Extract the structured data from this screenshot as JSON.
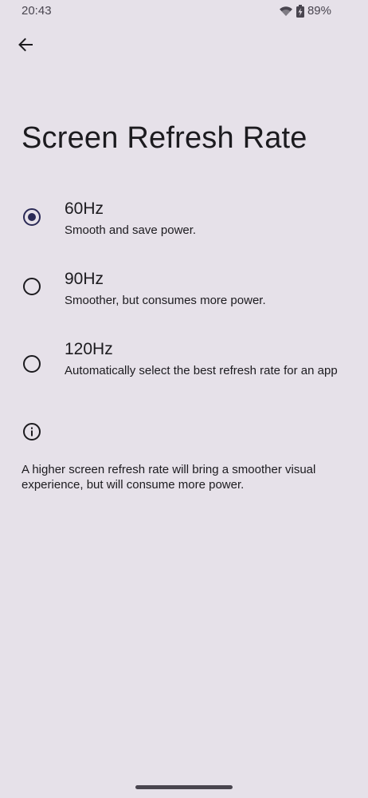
{
  "status_bar": {
    "time": "20:43",
    "battery_percent": "89%",
    "icons": [
      "wifi-icon",
      "battery-charging-icon"
    ]
  },
  "header": {
    "back_icon": "arrow-left-icon"
  },
  "page": {
    "title": "Screen Refresh Rate"
  },
  "options": [
    {
      "title": "60Hz",
      "summary": "Smooth and save power.",
      "selected": true
    },
    {
      "title": "90Hz",
      "summary": "Smoother, but consumes more power.",
      "selected": false
    },
    {
      "title": "120Hz",
      "summary": "Automatically select the best refresh rate for an app",
      "selected": false
    }
  ],
  "footer": {
    "info_icon": "info-icon",
    "text": "A higher screen refresh rate will bring a smoother visual experience, but will consume more power."
  },
  "colors": {
    "background": "#e6e1e9",
    "accent": "#2b2a56",
    "text": "#1c1b1f"
  }
}
